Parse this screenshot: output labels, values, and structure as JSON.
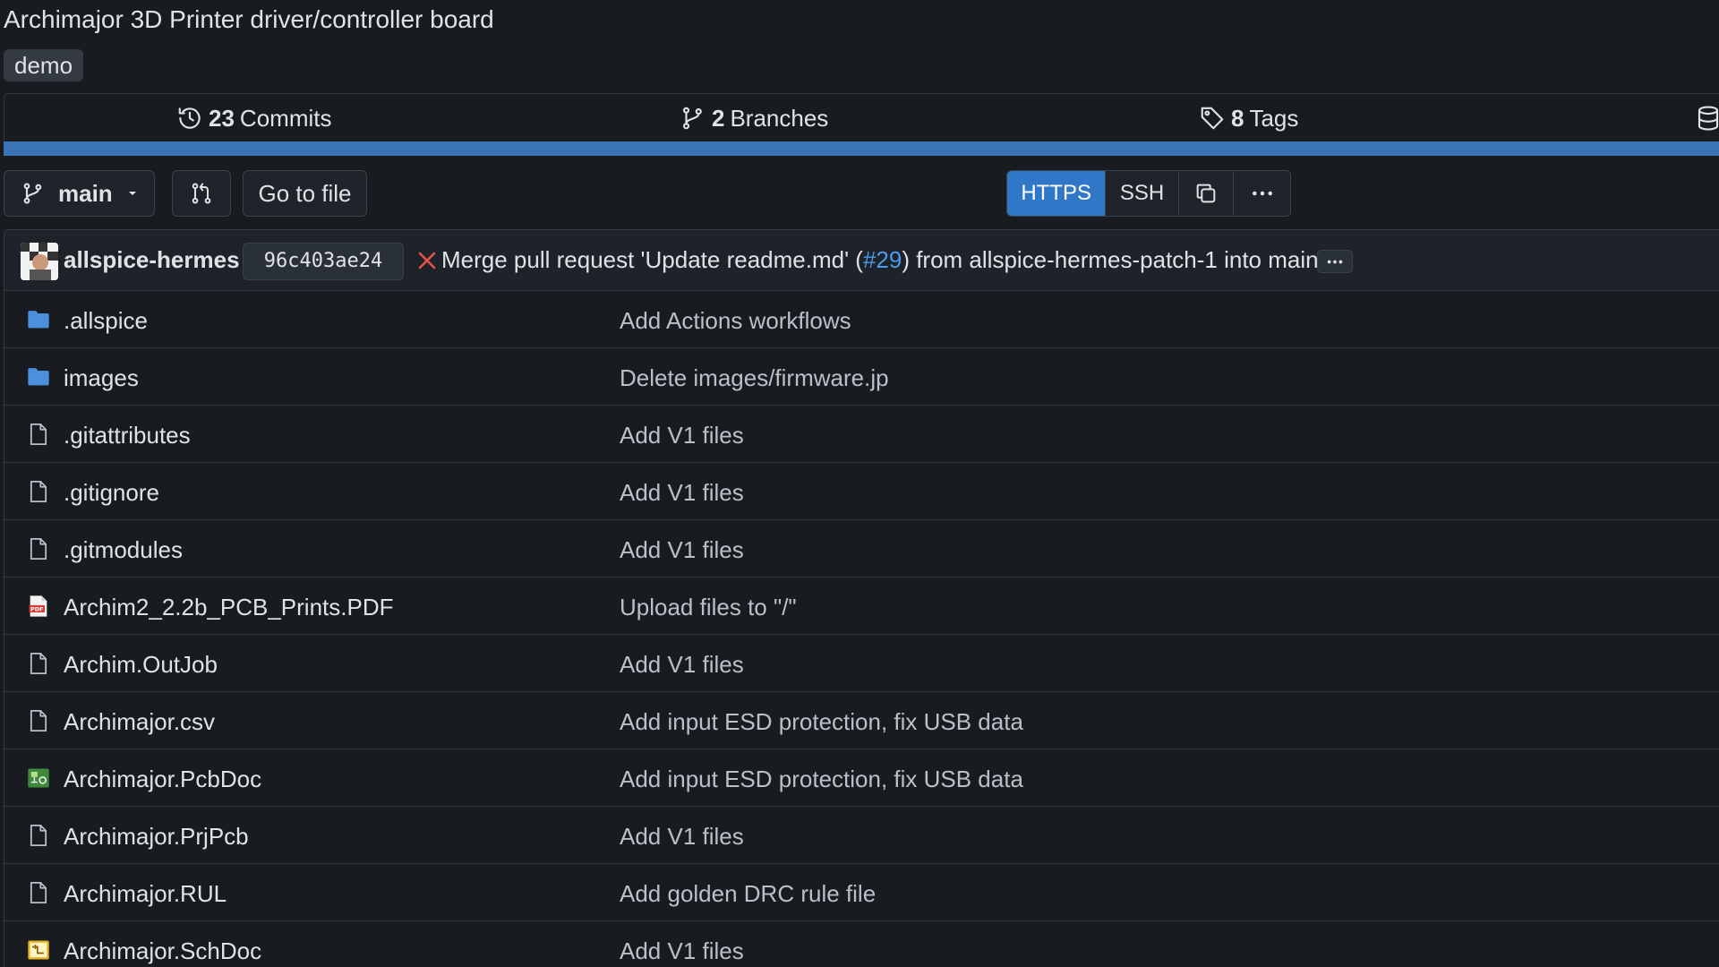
{
  "repo": {
    "description": "Archimajor 3D Printer driver/controller board",
    "topic": "demo"
  },
  "stats": {
    "commits_count": "23",
    "commits_label": "Commits",
    "branches_count": "2",
    "branches_label": "Branches",
    "tags_count": "8",
    "tags_label": "Tags"
  },
  "colors": {
    "language_bar": "#3a74b6",
    "accent": "#3077c7",
    "link": "#4c9be8",
    "error": "#e5534b",
    "folder": "#4c8fdb"
  },
  "toolbar": {
    "branch": "main",
    "go_to_file": "Go to file",
    "clone_https": "HTTPS",
    "clone_ssh": "SSH",
    "selected_protocol": "HTTPS"
  },
  "latest_commit": {
    "author": "allspice-hermes",
    "sha": "96c403ae24",
    "status": "failed",
    "message_prefix": "Merge pull request 'Update readme.md' (",
    "pr_link": "#29",
    "message_suffix": ") from allspice-hermes-patch-1 into main"
  },
  "files": [
    {
      "name": ".allspice",
      "type": "folder",
      "icon": "folder-icon",
      "message": "Add Actions workflows"
    },
    {
      "name": "images",
      "type": "folder",
      "icon": "folder-icon",
      "message": "Delete images/firmware.jp"
    },
    {
      "name": ".gitattributes",
      "type": "file",
      "icon": "file-icon",
      "message": "Add V1 files"
    },
    {
      "name": ".gitignore",
      "type": "file",
      "icon": "file-icon",
      "message": "Add V1 files"
    },
    {
      "name": ".gitmodules",
      "type": "file",
      "icon": "file-icon",
      "message": "Add V1 files"
    },
    {
      "name": "Archim2_2.2b_PCB_Prints.PDF",
      "type": "pdf",
      "icon": "pdf-file-icon",
      "message": "Upload files to \"/\""
    },
    {
      "name": "Archim.OutJob",
      "type": "file",
      "icon": "file-icon",
      "message": "Add V1 files"
    },
    {
      "name": "Archimajor.csv",
      "type": "file",
      "icon": "file-icon",
      "message": "Add input ESD protection, fix USB data"
    },
    {
      "name": "Archimajor.PcbDoc",
      "type": "pcb",
      "icon": "pcb-file-icon",
      "message": "Add input ESD protection, fix USB data"
    },
    {
      "name": "Archimajor.PrjPcb",
      "type": "file",
      "icon": "file-icon",
      "message": "Add V1 files"
    },
    {
      "name": "Archimajor.RUL",
      "type": "file",
      "icon": "file-icon",
      "message": "Add golden DRC rule file"
    },
    {
      "name": "Archimajor.SchDoc",
      "type": "sch",
      "icon": "schematic-file-icon",
      "message": "Add V1 files"
    }
  ]
}
